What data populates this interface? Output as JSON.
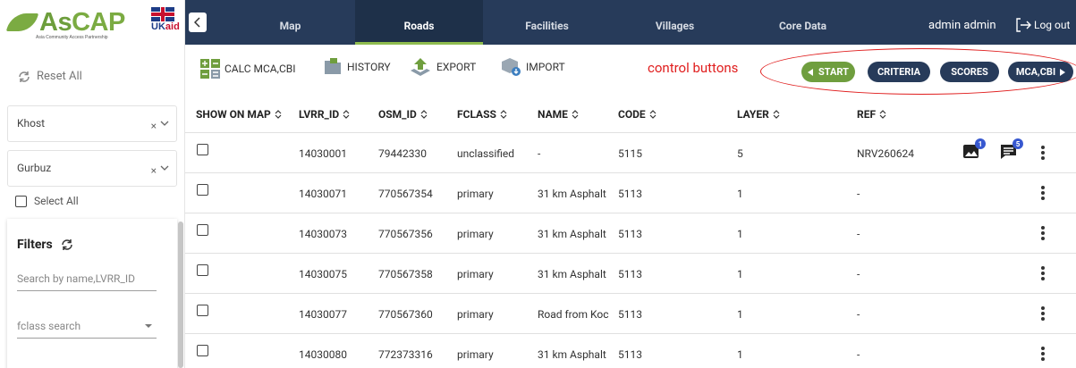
{
  "app": {
    "logo_text_a": "As",
    "logo_text_b": "CAP",
    "logo_subtitle": "Asia Community Access Partnership",
    "partner_logo_text_a": "UK",
    "partner_logo_text_b": "aid",
    "brand_color": "#7bab42",
    "nav_color": "#273b5a"
  },
  "nav": {
    "tabs": [
      {
        "label": "Map",
        "active": false
      },
      {
        "label": "Roads",
        "active": true
      },
      {
        "label": "Facilities",
        "active": false
      },
      {
        "label": "Villages",
        "active": false
      },
      {
        "label": "Core Data",
        "active": false
      }
    ],
    "user_name": "admin admin",
    "logout_label": "Log out"
  },
  "sidebar": {
    "reset_label": "Reset All",
    "province_value": "Khost",
    "district_value": "Gurbuz",
    "clear_symbol": "×",
    "select_all_label": "Select All",
    "filters_title": "Filters",
    "search_placeholder": "Search by name,LVRR_ID",
    "fclass_placeholder": "fclass search"
  },
  "toolbar": {
    "calc_label": "CALC MCA,CBI",
    "history_label": "HISTORY",
    "export_label": "EXPORT",
    "import_label": "IMPORT",
    "annotation": "control buttons",
    "start_label": "START",
    "criteria_label": "CRITERIA",
    "scores_label": "SCORES",
    "mca_label": "MCA,CBI"
  },
  "table": {
    "columns": [
      "SHOW ON MAP",
      "LVRR_ID",
      "OSM_ID",
      "FCLASS",
      "NAME",
      "CODE",
      "LAYER",
      "REF"
    ],
    "rows": [
      {
        "lvrr_id": "14030001",
        "osm_id": "79442330",
        "fclass": "unclassified",
        "name": "-",
        "code": "5115",
        "layer": "5",
        "ref": "NRV260624",
        "images": "1",
        "comments": "5"
      },
      {
        "lvrr_id": "14030071",
        "osm_id": "770567354",
        "fclass": "primary",
        "name": "31 km Asphalt",
        "code": "5113",
        "layer": "1",
        "ref": "-"
      },
      {
        "lvrr_id": "14030073",
        "osm_id": "770567356",
        "fclass": "primary",
        "name": "31 km Asphalt",
        "code": "5113",
        "layer": "1",
        "ref": "-"
      },
      {
        "lvrr_id": "14030075",
        "osm_id": "770567358",
        "fclass": "primary",
        "name": "31 km Asphalt",
        "code": "5113",
        "layer": "1",
        "ref": "-"
      },
      {
        "lvrr_id": "14030077",
        "osm_id": "770567360",
        "fclass": "primary",
        "name": "Road from Koc",
        "code": "5113",
        "layer": "1",
        "ref": "-"
      },
      {
        "lvrr_id": "14030080",
        "osm_id": "772373316",
        "fclass": "primary",
        "name": "31 km Asphalt",
        "code": "5113",
        "layer": "1",
        "ref": "-"
      }
    ]
  }
}
